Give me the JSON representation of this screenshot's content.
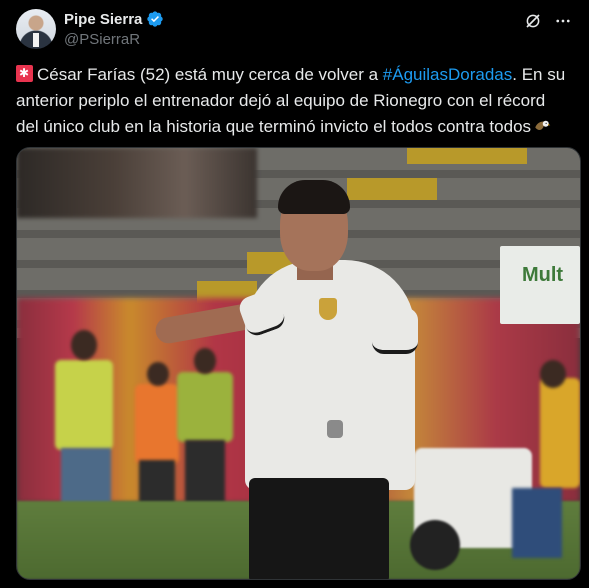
{
  "author": {
    "name": "Pipe Sierra",
    "handle": "@PSierraR",
    "verified": true
  },
  "tweet": {
    "line1_before": "César Farías (52) está muy cerca de volver a ",
    "hashtag": "#ÁguilasDoradas",
    "line1_after": ". En su",
    "line2": "anterior periplo el entrenador dejó al equipo de Rionegro con el récord",
    "line3": "del único club en la historia que terminó invicto el todos contra todos"
  },
  "media": {
    "sign_text": "Mult"
  },
  "icons": {
    "verified": "verified-badge-icon",
    "grok": "grok-icon",
    "more": "more-icon",
    "emoji_start": "siren-emoji-icon",
    "emoji_end": "eagle-emoji-icon"
  },
  "colors": {
    "background": "#000000",
    "text": "#e7e9ea",
    "secondary": "#71767b",
    "accent": "#1d9bf0"
  }
}
